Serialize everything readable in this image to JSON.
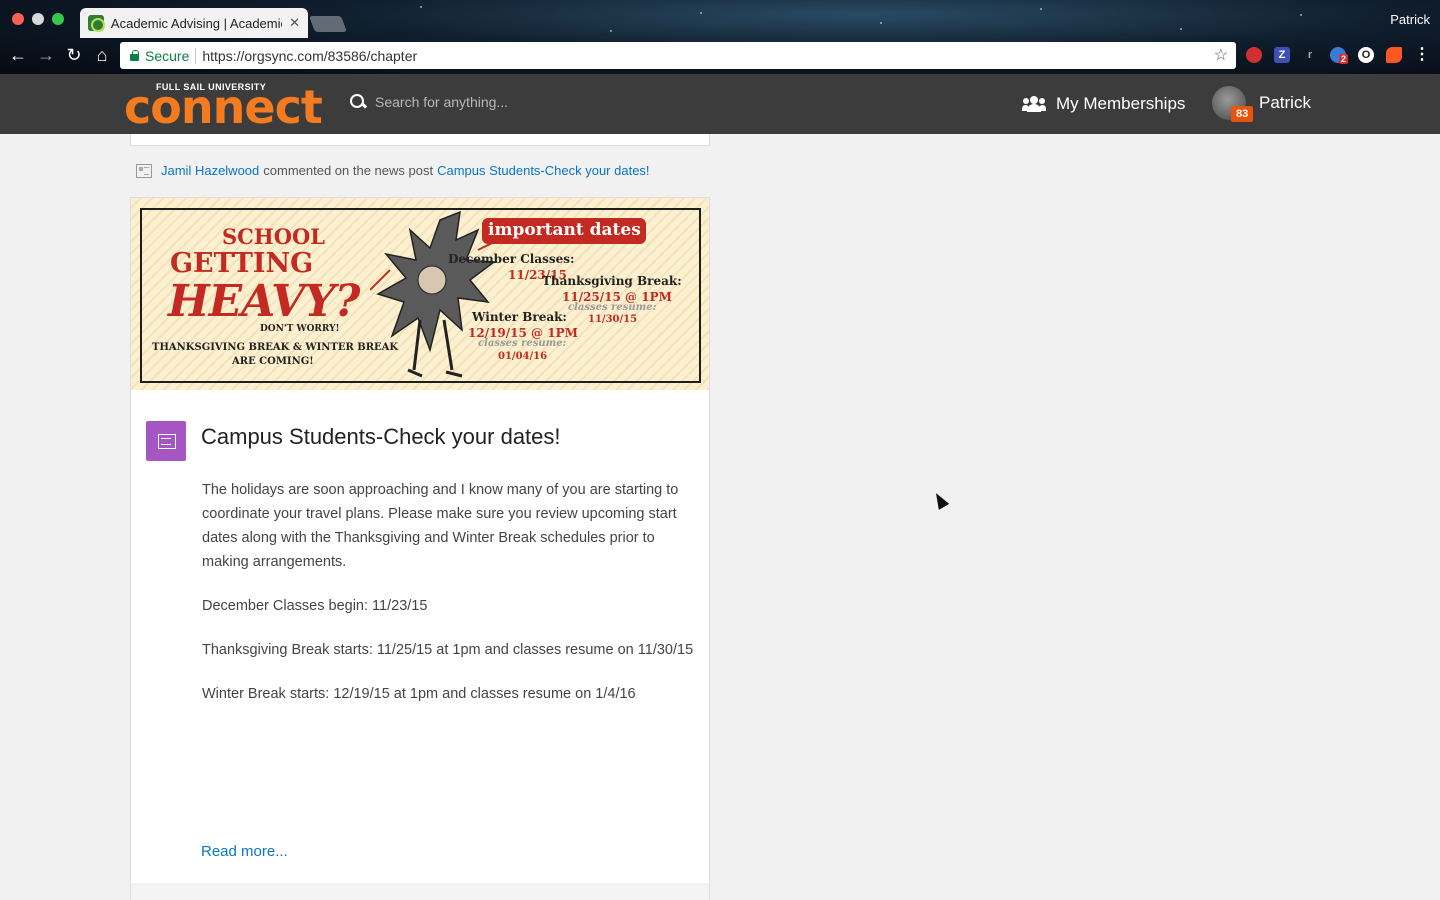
{
  "browser": {
    "tab_title": "Academic Advising | Academic",
    "tab_close": "✕",
    "profile_name": "Patrick",
    "secure_label": "Secure",
    "url": "https://orgsync.com/83586/chapter",
    "star": "☆",
    "nav": {
      "back": "←",
      "forward": "→",
      "reload": "↻",
      "home": "⌂"
    },
    "ext_badge": "2"
  },
  "site": {
    "logo_sub": "FULL SAIL UNIVERSITY",
    "logo_main": "connect",
    "search_placeholder": "Search for anything...",
    "memberships_label": "My Memberships",
    "notification_count": "83",
    "user_name": "Patrick",
    "accent_color": "#f47b20",
    "header_color": "#3c3c3c"
  },
  "activity": {
    "actor": "Jamil Hazelwood",
    "action": "commented on the news post",
    "target": "Campus Students-Check your dates!"
  },
  "banner": {
    "school": "SCHOOL",
    "getting": "GETTING",
    "heavy": "HEAVY?",
    "dont_worry": "DON'T WORRY!",
    "thanksgiving_winter": "THANKSGIVING BREAK & WINTER BREAK",
    "are_coming": "ARE COMING!",
    "important_dates": "important dates",
    "december_classes": "December Classes:",
    "december_date": "11/23/15",
    "thanksgiving_break": "Thanksgiving Break:",
    "thanksgiving_date": "11/25/15 @ 1PM",
    "thanksgiving_resume_label": "classes resume:",
    "thanksgiving_resume": "11/30/15",
    "winter_break": "Winter Break:",
    "winter_date": "12/19/15 @ 1PM",
    "winter_resume_label": "classes resume:",
    "winter_resume": "01/04/16"
  },
  "post": {
    "title": "Campus Students-Check your dates!",
    "paragraphs": [
      "The holidays are soon approaching and I know many of you are starting to coordinate your travel plans. Please make sure you review upcoming start dates along with the Thanksgiving and Winter Break schedules prior to making arrangements.",
      "December Classes begin: 11/23/15",
      "Thanksgiving Break starts: 11/25/15 at 1pm and classes resume on 11/30/15",
      "Winter Break starts: 12/19/15 at 1pm and classes resume on 1/4/16"
    ],
    "read_more": "Read more...",
    "icon_color": "#a457c2"
  }
}
